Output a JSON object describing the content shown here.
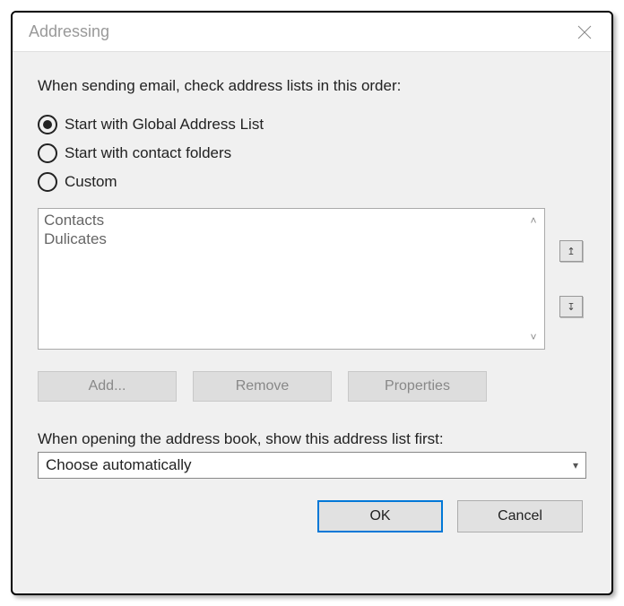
{
  "dialog": {
    "title": "Addressing",
    "instruction": "When sending email, check address lists in this order:",
    "radios": {
      "gal": "Start with Global Address List",
      "contacts": "Start with contact folders",
      "custom": "Custom",
      "selected": "gal"
    },
    "listbox": {
      "items": [
        "Contacts",
        "Dulicates"
      ]
    },
    "actions": {
      "add": "Add...",
      "remove": "Remove",
      "properties": "Properties"
    },
    "section2_label": "When opening the address book, show this address list first:",
    "dropdown_value": "Choose automatically",
    "footer": {
      "ok": "OK",
      "cancel": "Cancel"
    }
  }
}
